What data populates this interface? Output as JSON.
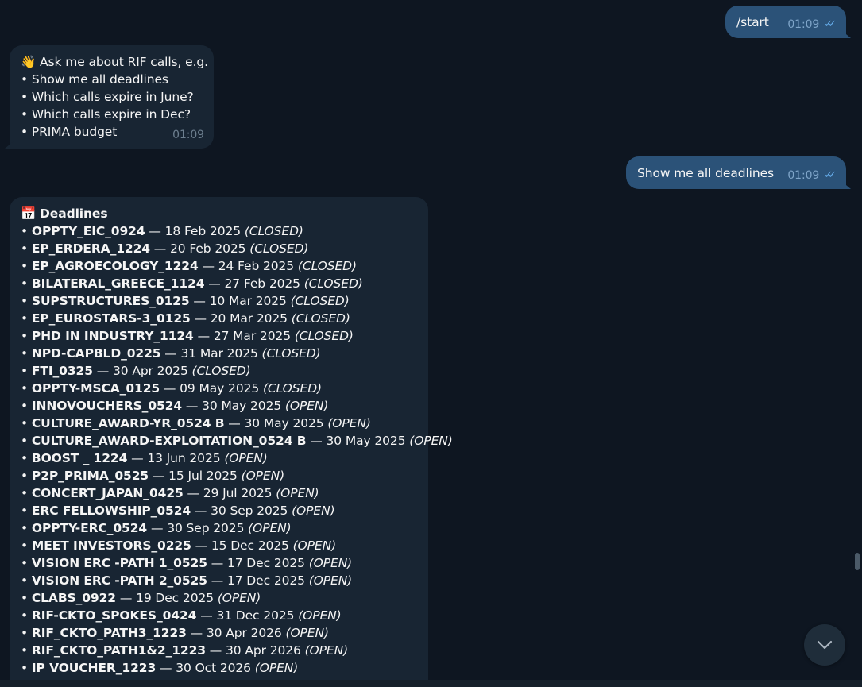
{
  "messages": {
    "start": {
      "text": "/start",
      "time": "01:09"
    },
    "welcome": {
      "lines": [
        "👋 Ask me about RIF calls, e.g.",
        "• Show me all deadlines",
        "• Which calls expire in June?",
        "• Which calls expire in Dec?",
        "• PRIMA budget"
      ],
      "time": "01:09"
    },
    "query": {
      "text": "Show me all deadlines",
      "time": "01:09"
    },
    "deadlines": {
      "heading_icon": "📅",
      "heading": "Deadlines",
      "items": [
        {
          "name": "OPPTY_EIC_0924",
          "date": "18 Feb 2025",
          "status": "(CLOSED)"
        },
        {
          "name": "EP_ERDERA_1224",
          "date": "20 Feb 2025",
          "status": "(CLOSED)"
        },
        {
          "name": "EP_AGROECOLOGY_1224",
          "date": "24 Feb 2025",
          "status": "(CLOSED)"
        },
        {
          "name": "BILATERAL_GREECE_1124",
          "date": "27 Feb 2025",
          "status": "(CLOSED)"
        },
        {
          "name": "SUPSTRUCTURES_0125",
          "date": "10 Mar 2025",
          "status": "(CLOSED)"
        },
        {
          "name": "EP_EUROSTARS-3_0125",
          "date": "20 Mar 2025",
          "status": "(CLOSED)"
        },
        {
          "name": "PHD IN INDUSTRY_1124",
          "date": "27 Mar 2025",
          "status": "(CLOSED)"
        },
        {
          "name": "NPD-CAPBLD_0225",
          "date": "31 Mar 2025",
          "status": "(CLOSED)"
        },
        {
          "name": "FTI_0325",
          "date": "30 Apr 2025",
          "status": "(CLOSED)"
        },
        {
          "name": "OPPTY-MSCA_0125",
          "date": "09 May 2025",
          "status": "(CLOSED)"
        },
        {
          "name": "INNOVOUCHERS_0524",
          "date": "30 May 2025",
          "status": "(OPEN)"
        },
        {
          "name": "CULTURE_AWARD-YR_0524 B",
          "date": "30 May 2025",
          "status": "(OPEN)"
        },
        {
          "name": "CULTURE_AWARD-EXPLOITATION_0524 B",
          "date": "30 May 2025",
          "status": "(OPEN)"
        },
        {
          "name": "BOOST _ 1224",
          "date": "13 Jun 2025",
          "status": "(OPEN)"
        },
        {
          "name": "P2P_PRIMA_0525",
          "date": "15 Jul 2025",
          "status": "(OPEN)"
        },
        {
          "name": "CONCERT_JAPAN_0425",
          "date": "29 Jul 2025",
          "status": "(OPEN)"
        },
        {
          "name": "ERC FELLOWSHIP_0524",
          "date": "30 Sep 2025",
          "status": "(OPEN)"
        },
        {
          "name": "OPPTY-ERC_0524",
          "date": "30 Sep 2025",
          "status": "(OPEN)"
        },
        {
          "name": "MEET INVESTORS_0225",
          "date": "15 Dec 2025",
          "status": "(OPEN)"
        },
        {
          "name": "VISION ERC -PATH 1_0525",
          "date": "17 Dec 2025",
          "status": "(OPEN)"
        },
        {
          "name": "VISION ERC -PATH 2_0525",
          "date": "17 Dec 2025",
          "status": "(OPEN)"
        },
        {
          "name": "CLABS_0922",
          "date": "19 Dec 2025",
          "status": "(OPEN)"
        },
        {
          "name": "RIF-CKTO_SPOKES_0424",
          "date": "31 Dec 2025",
          "status": "(OPEN)"
        },
        {
          "name": "RIF_CKTO_PATH3_1223",
          "date": "30 Apr 2026",
          "status": "(OPEN)"
        },
        {
          "name": "RIF_CKTO_PATH1&2_1223",
          "date": "30 Apr 2026",
          "status": "(OPEN)"
        },
        {
          "name": "IP VOUCHER_1223",
          "date": "30 Oct 2026",
          "status": "(OPEN)"
        }
      ],
      "separator": " — "
    }
  },
  "icons": {
    "read_receipt": "double-check-icon",
    "scroll_down": "chevron-down-icon"
  },
  "colors": {
    "background": "#0e1621",
    "outgoing_bubble": "#2b5278",
    "incoming_bubble": "#182533",
    "read_tick": "#6ab3f3"
  }
}
